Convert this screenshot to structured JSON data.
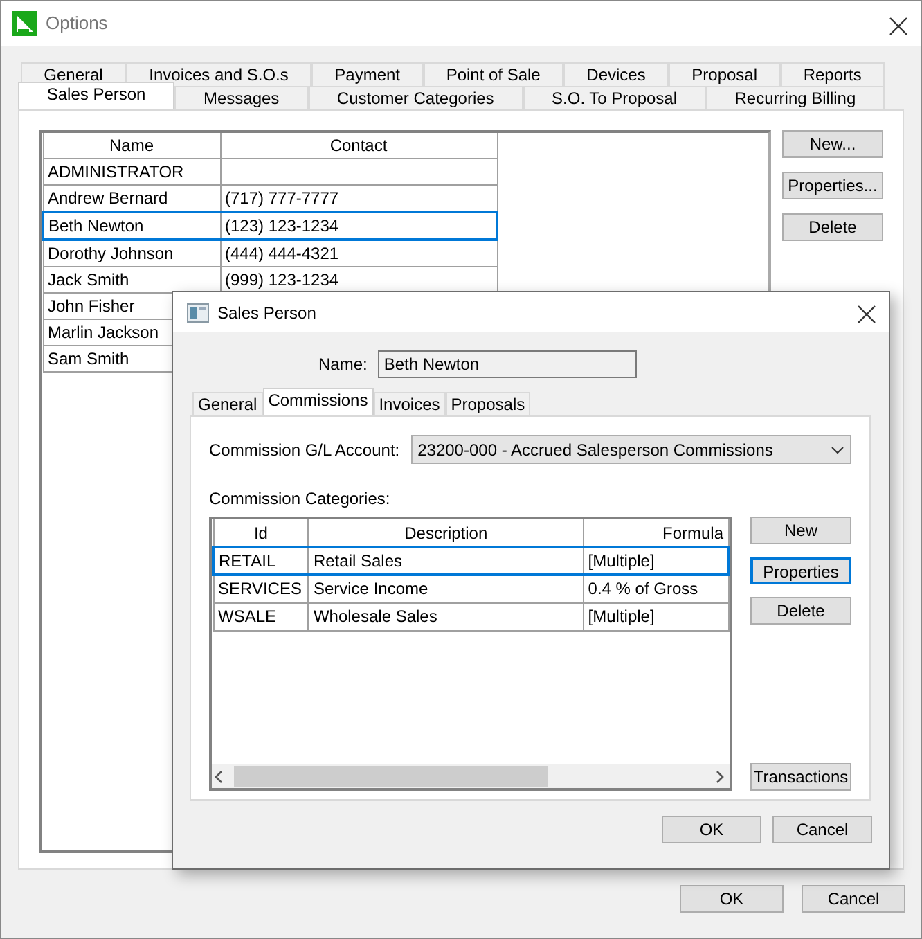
{
  "window": {
    "title": "Options"
  },
  "tabs_row_1": [
    {
      "label": "General",
      "selected": false
    },
    {
      "label": "Invoices and S.O.s",
      "selected": false
    },
    {
      "label": "Payment",
      "selected": false
    },
    {
      "label": "Point of Sale",
      "selected": false
    },
    {
      "label": "Devices",
      "selected": false
    },
    {
      "label": "Proposal",
      "selected": false
    },
    {
      "label": "Reports",
      "selected": false
    }
  ],
  "tabs_row_2": [
    {
      "label": "Sales Person",
      "selected": true
    },
    {
      "label": "Messages",
      "selected": false
    },
    {
      "label": "Customer Categories",
      "selected": false
    },
    {
      "label": "S.O. To Proposal",
      "selected": false
    },
    {
      "label": "Recurring Billing",
      "selected": false
    }
  ],
  "sales_people": {
    "columns": [
      "Name",
      "Contact"
    ],
    "rows": [
      {
        "name": "ADMINISTRATOR",
        "selected": false
      },
      {
        "name": "Andrew Bernard",
        "contact": "(717) 777-7777",
        "selected": false
      },
      {
        "name": "Beth Newton",
        "contact": "(123) 123-1234",
        "selected": true
      },
      {
        "name": "Dorothy Johnson",
        "contact": "(444) 444-4321",
        "selected": false
      },
      {
        "name": "Jack Smith",
        "contact": "(999) 123-1234",
        "selected": false
      },
      {
        "name": "John Fisher",
        "selected": false
      },
      {
        "name": "Marlin Jackson",
        "selected": false
      },
      {
        "name": "Sam Smith",
        "selected": false
      }
    ]
  },
  "side_buttons": [
    "New...",
    "Properties...",
    "Delete"
  ],
  "footer_buttons": [
    "OK",
    "Cancel"
  ],
  "dialog": {
    "title": "Sales Person",
    "name_label": "Name:",
    "name_value": "Beth Newton",
    "tabs": [
      {
        "label": "General",
        "selected": false
      },
      {
        "label": "Commissions",
        "selected": true
      },
      {
        "label": "Invoices",
        "selected": false
      },
      {
        "label": "Proposals",
        "selected": false
      }
    ],
    "account_label": "Commission G/L Account:",
    "account_value": "23200-000 - Accrued Salesperson Commissions",
    "categories_label": "Commission Categories:",
    "categories": {
      "columns": [
        "Id",
        "Description",
        "Formula"
      ],
      "rows": [
        {
          "id": "RETAIL",
          "description": "Retail Sales",
          "formula": "[Multiple]",
          "selected": true
        },
        {
          "id": "SERVICES",
          "description": "Service Income",
          "formula": "0.4 % of Gross",
          "selected": false
        },
        {
          "id": "WSALE",
          "description": "Wholesale Sales",
          "formula": "[Multiple]",
          "selected": false
        }
      ]
    },
    "buttons": [
      {
        "label": "New",
        "focused": false
      },
      {
        "label": "Properties",
        "focused": true
      },
      {
        "label": "Delete",
        "focused": false
      }
    ],
    "transactions_button": "Transactions",
    "footer_buttons": [
      "OK",
      "Cancel"
    ]
  }
}
